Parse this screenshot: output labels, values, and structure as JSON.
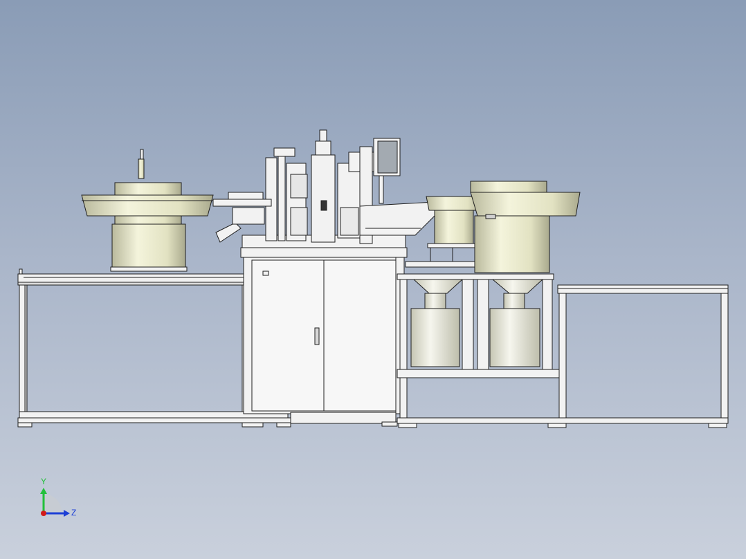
{
  "viewport": {
    "background_top": "#8a9cb6",
    "background_bottom": "#c9d0dc"
  },
  "colors": {
    "line": "#1f1f1f",
    "frame_fill": "#f4f4f4",
    "bowl_fill": "#e7e7c6",
    "bowl_shade": "#b7b79a",
    "screen_fill": "#9fa6ad"
  },
  "triad": {
    "y_label": "Y",
    "z_label": "Z",
    "y_color": "#22c03a",
    "z_color": "#1d3fd6",
    "x_color": "#d21a1a"
  }
}
